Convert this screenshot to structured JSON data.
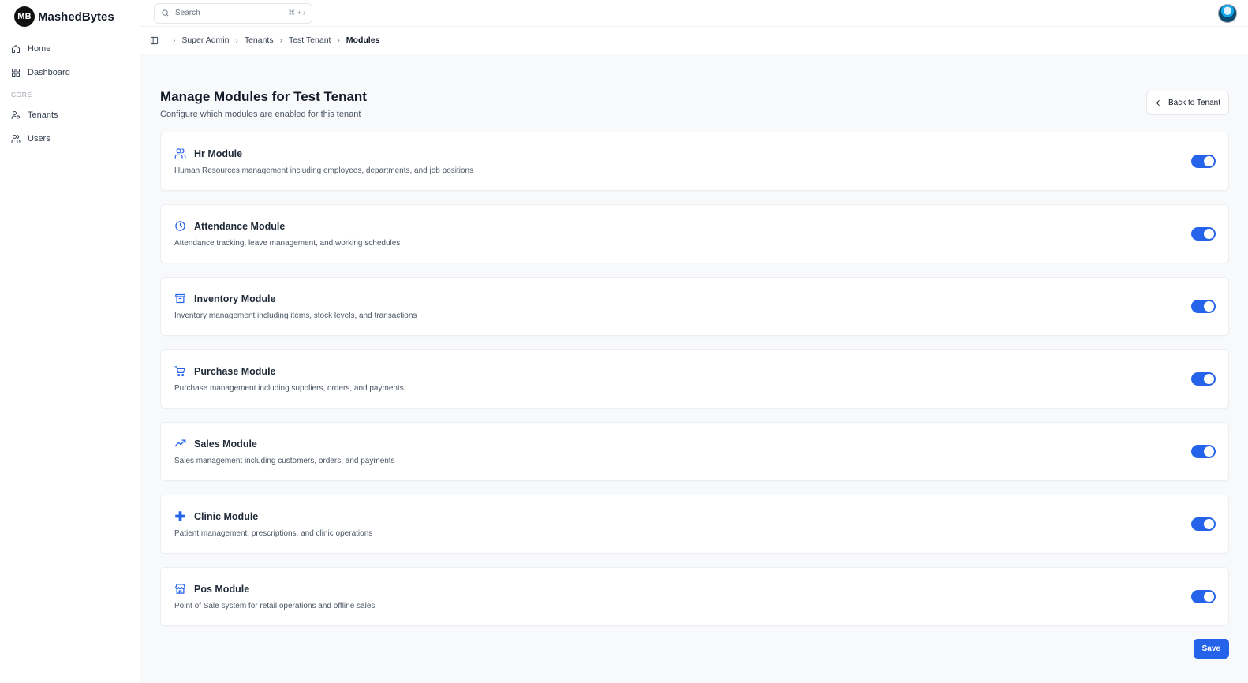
{
  "brand": {
    "logo_text": "MB",
    "name": "MashedBytes"
  },
  "sidebar": {
    "items_top": [
      {
        "label": "Home",
        "icon": "home-icon"
      },
      {
        "label": "Dashboard",
        "icon": "grid-icon"
      }
    ],
    "group_label": "CORE",
    "items_core": [
      {
        "label": "Tenants",
        "icon": "user-gear-icon"
      },
      {
        "label": "Users",
        "icon": "users-icon"
      }
    ]
  },
  "topbar": {
    "search_placeholder": "Search",
    "search_shortcut": "⌘ + /"
  },
  "breadcrumb": [
    "Super Admin",
    "Tenants",
    "Test Tenant",
    "Modules"
  ],
  "page": {
    "title": "Manage Modules for Test Tenant",
    "subtitle": "Configure which modules are enabled for this tenant",
    "back_label": "Back to Tenant",
    "save_label": "Save"
  },
  "modules": [
    {
      "title": "Hr Module",
      "description": "Human Resources management including employees, departments, and job positions",
      "icon": "users-icon",
      "enabled": true
    },
    {
      "title": "Attendance Module",
      "description": "Attendance tracking, leave management, and working schedules",
      "icon": "clock-icon",
      "enabled": true
    },
    {
      "title": "Inventory Module",
      "description": "Inventory management including items, stock levels, and transactions",
      "icon": "archive-icon",
      "enabled": true
    },
    {
      "title": "Purchase Module",
      "description": "Purchase management including suppliers, orders, and payments",
      "icon": "cart-icon",
      "enabled": true
    },
    {
      "title": "Sales Module",
      "description": "Sales management including customers, orders, and payments",
      "icon": "trending-up-icon",
      "enabled": true
    },
    {
      "title": "Clinic Module",
      "description": "Patient management, prescriptions, and clinic operations",
      "icon": "plus-icon",
      "enabled": true
    },
    {
      "title": "Pos Module",
      "description": "Point of Sale system for retail operations and offline sales",
      "icon": "store-icon",
      "enabled": true
    }
  ],
  "colors": {
    "accent": "#2563eb",
    "background": "#f8f9fb"
  }
}
